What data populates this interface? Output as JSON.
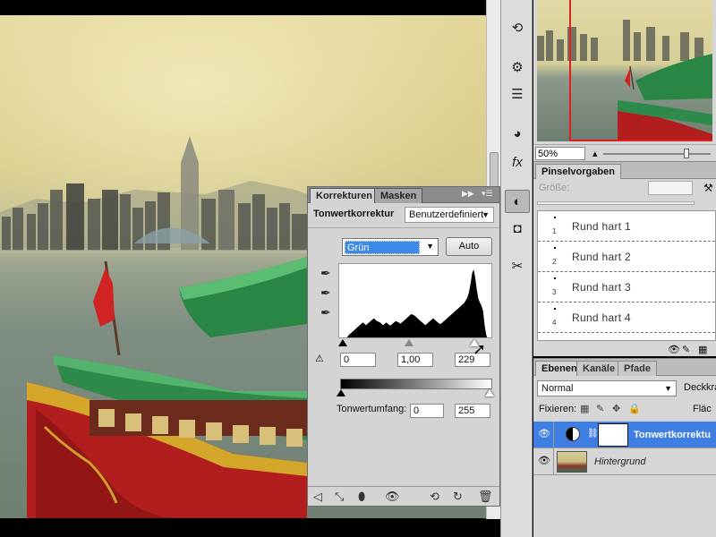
{
  "navigator": {
    "zoom": "50%"
  },
  "brush_panel": {
    "tab_label": "Pinselvorgaben",
    "size_label": "Größe:",
    "items": [
      {
        "num": "1",
        "label": "Rund hart 1"
      },
      {
        "num": "2",
        "label": "Rund hart 2"
      },
      {
        "num": "3",
        "label": "Rund hart 3"
      },
      {
        "num": "4",
        "label": "Rund hart 4"
      }
    ]
  },
  "layers_panel": {
    "tabs": [
      "Ebenen",
      "Kanäle",
      "Pfade"
    ],
    "blend_mode": "Normal",
    "opacity_label": "Deckkra",
    "lock_label": "Fixieren:",
    "fill_label": "Fläc",
    "layers": [
      {
        "name": "Tonwertkorrektu",
        "active": true
      },
      {
        "name": "Hintergrund",
        "active": false
      }
    ]
  },
  "adjustments_panel": {
    "tabs": [
      "Korrekturen",
      "Masken"
    ],
    "title": "Tonwertkorrektur",
    "preset": "Benutzerdefiniert",
    "channel": "Grün",
    "auto_label": "Auto",
    "input_levels": {
      "black": "0",
      "gamma": "1,00",
      "white": "229"
    },
    "output_label": "Tonwertumfang:",
    "output_levels": {
      "black": "0",
      "white": "255"
    },
    "histogram": {
      "type": "area",
      "x_range": [
        0,
        255
      ],
      "note": "histogram of green channel, peak near 225",
      "values": [
        0,
        0,
        1,
        2,
        3,
        6,
        8,
        10,
        12,
        14,
        16,
        18,
        20,
        22,
        24,
        22,
        20,
        22,
        24,
        26,
        28,
        30,
        28,
        26,
        25,
        24,
        22,
        20,
        22,
        24,
        22,
        20,
        20,
        22,
        24,
        26,
        25,
        24,
        22,
        24,
        26,
        28,
        30,
        32,
        34,
        36,
        35,
        34,
        32,
        30,
        28,
        26,
        24,
        22,
        20,
        22,
        24,
        26,
        28,
        30,
        28,
        26,
        24,
        22,
        22,
        24,
        26,
        28,
        30,
        32,
        34,
        36,
        38,
        40,
        42,
        44,
        46,
        48,
        50,
        52,
        56,
        60,
        68,
        80,
        95,
        100,
        88,
        70,
        58,
        52,
        48,
        40,
        20,
        6,
        0
      ]
    }
  },
  "colors": {
    "selection_blue": "#3f7fe4",
    "channel_highlight": "#3d8ae6",
    "navigator_frame": "#e02020"
  }
}
